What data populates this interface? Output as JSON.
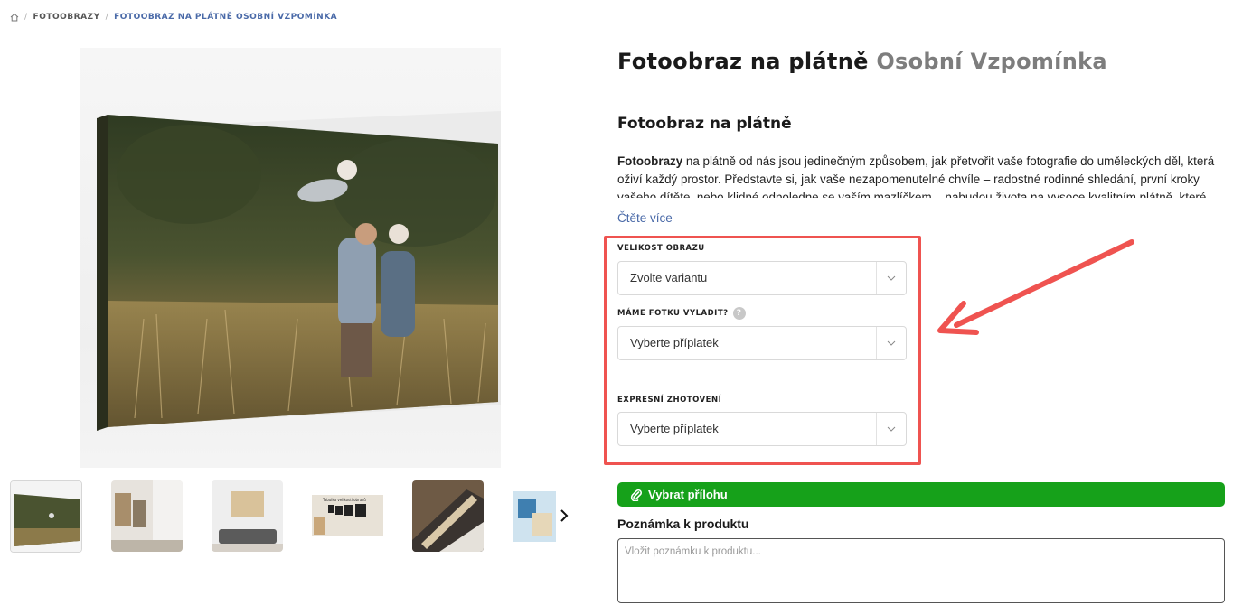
{
  "breadcrumb": {
    "items": [
      "FOTOOBRAZY",
      "FOTOOBRAZ NA PLÁTNĚ OSOBNÍ VZPOMÍNKA"
    ],
    "separator": "/"
  },
  "product": {
    "title_main": "Fotoobraz na plátně",
    "title_sub": "Osobní Vzpomínka"
  },
  "description": {
    "heading": "Fotoobraz na plátně",
    "lead_bold": "Fotoobrazy",
    "text": " na plátně od nás jsou jedinečným způsobem, jak přetvořit vaše fotografie do uměleckých děl, která oživí každý prostor. Představte si, jak vaše nezapomenutelné chvíle – radostné rodinné shledání, první kroky vašeho dítěte, nebo klidné odpoledne se vaším mazlíčkem – nabudou života na vysoce kvalitním plátně, které zdobí vaši stěnu.",
    "read_more": "Čtěte více"
  },
  "options": {
    "size": {
      "label": "VELIKOST OBRAZU",
      "value": "Zvolte variantu"
    },
    "retouch": {
      "label": "MÁME FOTKU VYLADIT?",
      "help": "?",
      "value": "Vyberte příplatek"
    },
    "express": {
      "label": "EXPRESNÍ ZHOTOVENÍ",
      "value": "Vyberte příplatek"
    }
  },
  "attachment": {
    "button_label": "Vybrat přílohu"
  },
  "note": {
    "label": "Poznámka k produktu",
    "placeholder": "Vložit poznámku k produktu..."
  },
  "thumbnail_preview_text": "Tabulka velikosti obrazů",
  "colors": {
    "accent_blue": "#4a6aa8",
    "highlight_red": "#ef5350",
    "button_green": "#16a11a"
  }
}
